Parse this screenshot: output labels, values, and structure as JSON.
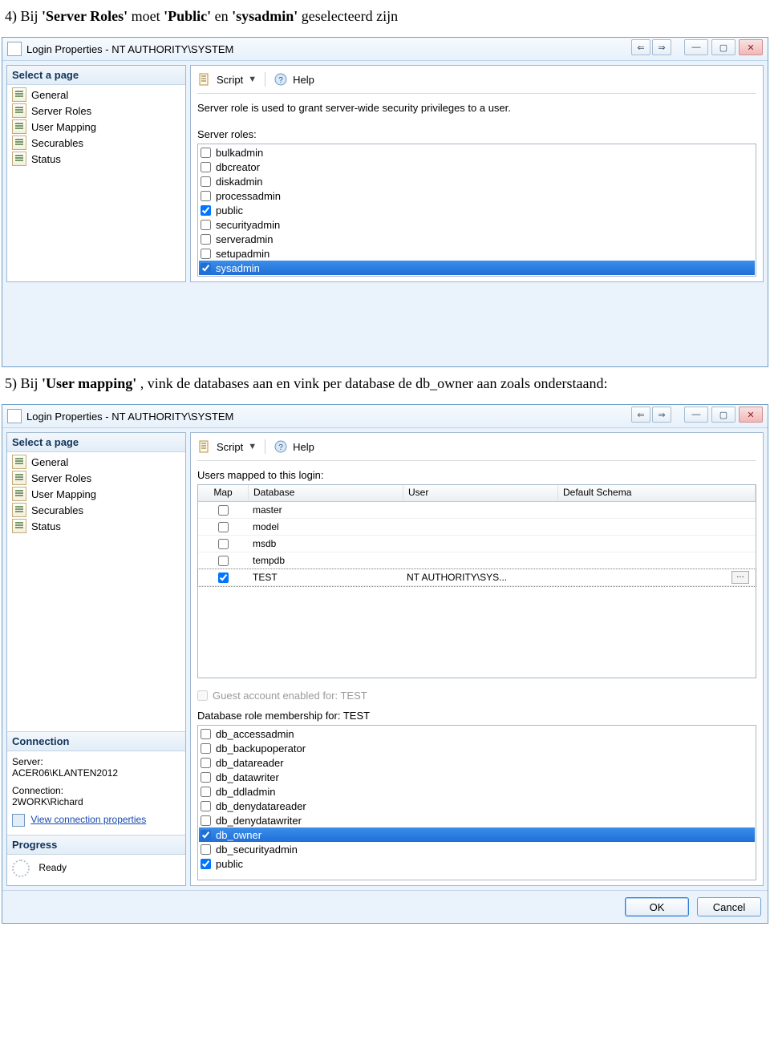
{
  "doc": {
    "step4_prefix": "4) Bij ",
    "step4_b1": "'Server Roles'",
    "step4_mid": " moet ",
    "step4_b2": "'Public'",
    "step4_and": " en ",
    "step4_b3": "'sysadmin'",
    "step4_suffix": " geselecteerd zijn",
    "step5_prefix": "5) Bij ",
    "step5_b1": "'User mapping'",
    "step5_suffix": ",  vink de databases aan en vink per database de db_owner aan zoals onderstaand:"
  },
  "win1": {
    "title": "Login Properties - NT AUTHORITY\\SYSTEM",
    "sidebar_header": "Select a page",
    "pages": {
      "p0": "General",
      "p1": "Server Roles",
      "p2": "User Mapping",
      "p3": "Securables",
      "p4": "Status"
    },
    "toolbar": {
      "script": "Script",
      "help": "Help"
    },
    "desc": "Server role is used to grant server-wide security privileges to a user.",
    "roles_label": "Server roles:",
    "roles": {
      "r0": "bulkadmin",
      "r1": "dbcreator",
      "r2": "diskadmin",
      "r3": "processadmin",
      "r4": "public",
      "r5": "securityadmin",
      "r6": "serveradmin",
      "r7": "setupadmin",
      "r8": "sysadmin"
    }
  },
  "win2": {
    "title": "Login Properties - NT AUTHORITY\\SYSTEM",
    "sidebar_header": "Select a page",
    "pages": {
      "p0": "General",
      "p1": "Server Roles",
      "p2": "User Mapping",
      "p3": "Securables",
      "p4": "Status"
    },
    "toolbar": {
      "script": "Script",
      "help": "Help"
    },
    "map_label": "Users mapped to this login:",
    "cols": {
      "map": "Map",
      "db": "Database",
      "user": "User",
      "schema": "Default Schema"
    },
    "rows": {
      "r0": {
        "db": "master",
        "user": "",
        "schema": ""
      },
      "r1": {
        "db": "model",
        "user": "",
        "schema": ""
      },
      "r2": {
        "db": "msdb",
        "user": "",
        "schema": ""
      },
      "r3": {
        "db": "tempdb",
        "user": "",
        "schema": ""
      },
      "r4": {
        "db": "TEST",
        "user": "NT AUTHORITY\\SYS...",
        "schema": ""
      }
    },
    "guest": "Guest account enabled for: TEST",
    "membership": "Database role membership for: TEST",
    "dbroles": {
      "d0": "db_accessadmin",
      "d1": "db_backupoperator",
      "d2": "db_datareader",
      "d3": "db_datawriter",
      "d4": "db_ddladmin",
      "d5": "db_denydatareader",
      "d6": "db_denydatawriter",
      "d7": "db_owner",
      "d8": "db_securityadmin",
      "d9": "public"
    },
    "conn": {
      "header": "Connection",
      "server_lbl": "Server:",
      "server": "ACER06\\KLANTEN2012",
      "conn_lbl": "Connection:",
      "conn": "2WORK\\Richard",
      "link": "View connection properties"
    },
    "progress": {
      "header": "Progress",
      "ready": "Ready"
    },
    "buttons": {
      "ok": "OK",
      "cancel": "Cancel"
    }
  }
}
